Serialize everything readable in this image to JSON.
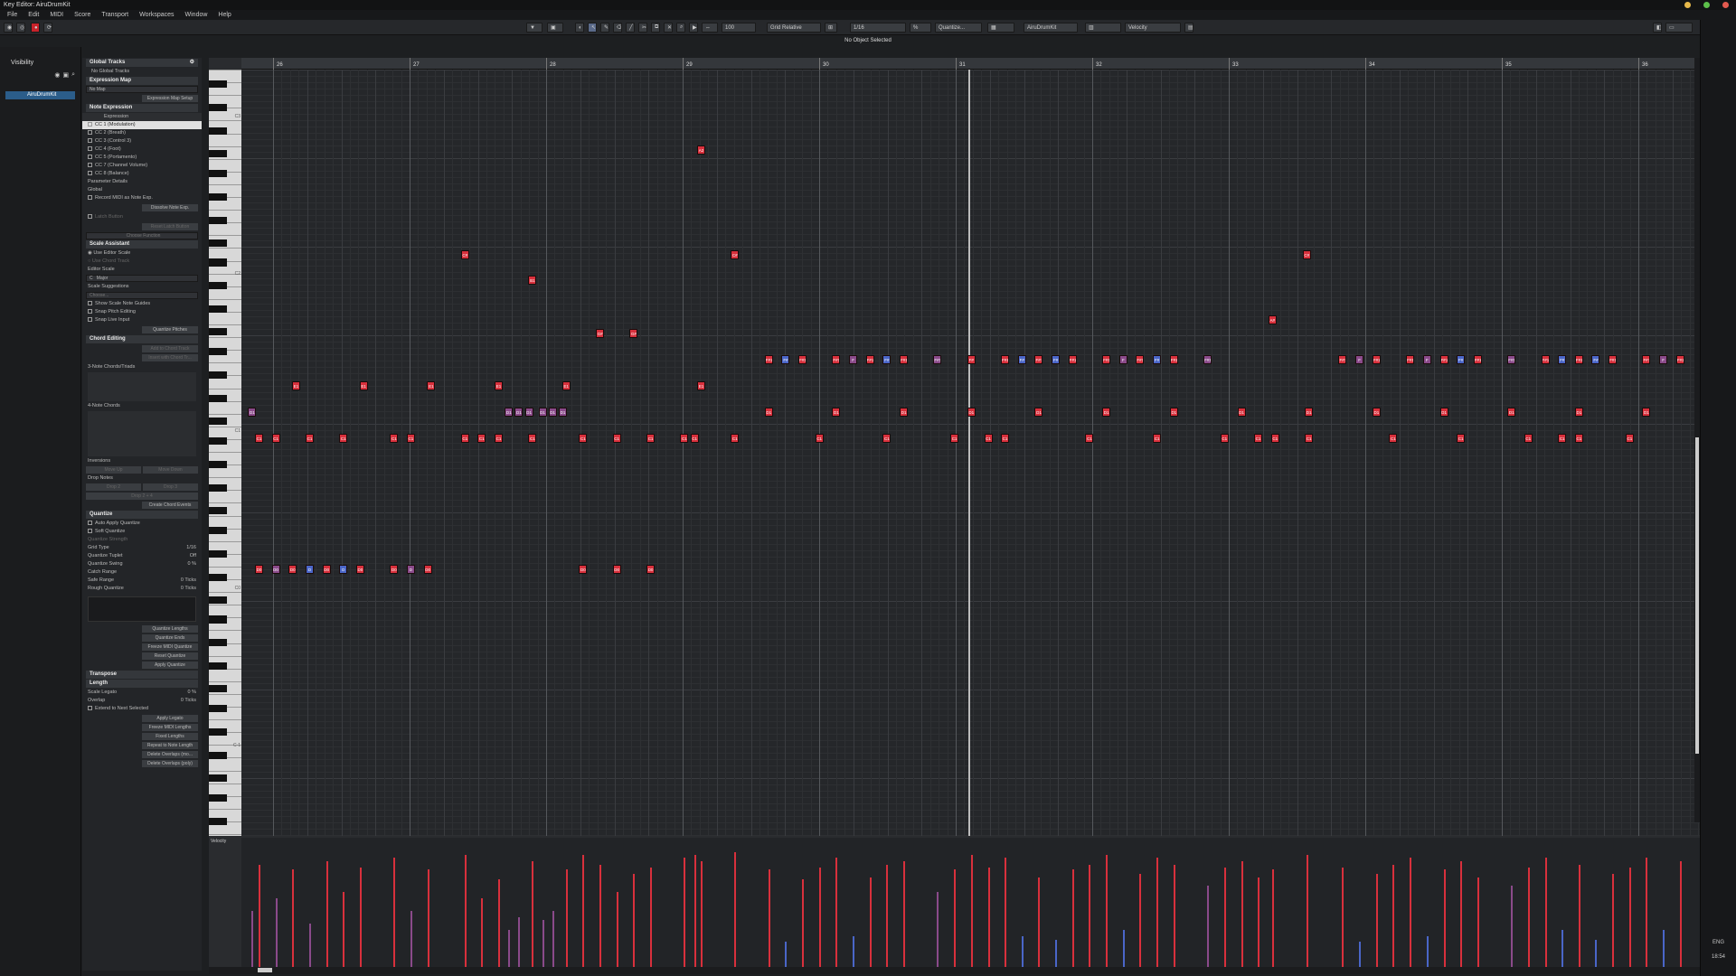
{
  "app": {
    "title": "Key Editor: AiruDrumKit"
  },
  "menu": [
    "File",
    "Edit",
    "MIDI",
    "Score",
    "Transport",
    "Workspaces",
    "Window",
    "Help"
  ],
  "toolbar": {
    "zoom": "100",
    "grid_mode": "Grid Relative",
    "grid_value": "1/16",
    "quantize": "Quantize...",
    "instrument": "AiruDrumKit",
    "controller": "Velocity"
  },
  "status": "No Object Selected",
  "visibility": {
    "title": "Visibility",
    "track": "AiruDrumKit"
  },
  "inspector": {
    "global_tracks": "Global Tracks",
    "no_global": "No Global Tracks",
    "expression_map": "Expression Map",
    "no_map": "No Map",
    "map_setup": "Expression Map Setup",
    "note_expression": "Note Expression",
    "expr_header": "Expression",
    "cc": [
      "CC 1 (Modulation)",
      "CC 2 (Breath)",
      "CC 3 (Control 3)",
      "CC 4 (Foot)",
      "CC 5 (Portamento)",
      "CC 7 (Channel Volume)",
      "CC 8 (Balance)"
    ],
    "param_details": "Parameter Details",
    "global": "Global",
    "record_midi": "Record MIDI as Note Exp.",
    "dissolve": "Dissolve Note Exp.",
    "latch": "Latch Button",
    "reset_latch": "Reset Latch Button",
    "choose_function": "Choose Function",
    "scale_assistant": "Scale Assistant",
    "use_editor_scale": "Use Editor Scale",
    "use_chord_track": "Use Chord Track",
    "editor_scale": "Editor Scale",
    "scale_key": "C",
    "scale_mode": "Major",
    "scale_suggestions": "Scale Suggestions",
    "choose": "Choose...",
    "show_guides": "Show Scale Note Guides",
    "snap_pitch": "Snap Pitch Editing",
    "snap_live": "Snap Live Input",
    "quantize_pitches": "Quantize Pitches",
    "chord_editing": "Chord Editing",
    "add_chord": "Add to Chord Track",
    "insert_chord": "Insert with Chord Tr...",
    "three_note": "3-Note Chords/Triads",
    "four_note": "4-Note Chords",
    "inversions": "Inversions",
    "move_up": "Move Up",
    "move_down": "Move Down",
    "drop_notes": "Drop Notes",
    "drop2": "Drop 2",
    "drop3": "Drop 3",
    "drop24": "Drop 2 + 4",
    "create_chord": "Create Chord Events",
    "quantize": "Quantize",
    "auto_apply": "Auto Apply Quantize",
    "soft_quantize": "Soft Quantize",
    "q_strength": "Quantize Strength",
    "grid_type": "Grid Type",
    "grid_type_val": "1/16",
    "q_tuplet": "Quantize Tuplet",
    "q_tuplet_val": "Off",
    "q_swing": "Quantize Swing",
    "q_swing_val": "0 %",
    "catch": "Catch Range",
    "safe": "Safe Range",
    "safe_val": "0 Ticks",
    "rough": "Rough Quantize",
    "rough_val": "0 Ticks",
    "q_lengths": "Quantize Lengths",
    "q_ends": "Quantize Ends",
    "freeze": "Freeze MIDI Quantize",
    "reset_q": "Reset Quantize",
    "apply_q": "Apply Quantize",
    "transpose": "Transpose",
    "length": "Length",
    "scale_legato": "Scale Legato",
    "scale_legato_val": "0 %",
    "overlap": "Overlap",
    "overlap_val": "0 Ticks",
    "extend": "Extend to Next Selected",
    "apply_legato": "Apply Legato",
    "freeze_lengths": "Freeze MIDI Lengths",
    "fixed_lengths": "Fixed Lengths",
    "repeat_length": "Repeat to Note Length",
    "delete_overlaps_mono": "Delete Overlaps (mo...",
    "delete_overlaps_poly": "Delete Overlaps (poly)"
  },
  "ruler": [
    "26",
    "27",
    "28",
    "29",
    "30",
    "31",
    "32",
    "33",
    "34",
    "35",
    "36"
  ],
  "keyboard_labels": [
    "C3",
    "C2",
    "C1",
    "C0",
    "C-1"
  ],
  "velocity_label": "Velocity",
  "clock": "18:54",
  "lang": "ENG",
  "colors": {
    "note_red": "#d8303c",
    "note_blue": "#4a66c8",
    "note_purple": "#8a4a8a"
  },
  "notes": [
    {
      "t": "A2",
      "x": 0.3125,
      "row": 0,
      "c": "r"
    },
    {
      "t": "C#",
      "x": 0.1505,
      "row": 1,
      "c": "r"
    },
    {
      "t": "C#",
      "x": 0.3356,
      "row": 1,
      "c": "r"
    },
    {
      "t": "C#",
      "x": 0.7277,
      "row": 1,
      "c": "r"
    },
    {
      "t": "B1",
      "x": 0.1968,
      "row": 2,
      "c": "r"
    },
    {
      "t": "A#",
      "x": 0.7041,
      "row": 3,
      "c": "r"
    },
    {
      "t": "G#",
      "x": 0.2431,
      "row": 4,
      "c": "r"
    },
    {
      "t": "G#",
      "x": 0.2662,
      "row": 4,
      "c": "r"
    },
    {
      "t": "F#1",
      "x": 0.3588,
      "row": 5,
      "c": "r"
    },
    {
      "t": "F#",
      "x": 0.3704,
      "row": 5,
      "c": "b"
    },
    {
      "t": "F#1",
      "x": 0.382,
      "row": 5,
      "c": "r"
    },
    {
      "t": "F#1",
      "x": 0.4051,
      "row": 5,
      "c": "r"
    },
    {
      "t": "F",
      "x": 0.4167,
      "row": 5,
      "c": "p"
    },
    {
      "t": "F#1",
      "x": 0.4282,
      "row": 5,
      "c": "r"
    },
    {
      "t": "F#",
      "x": 0.4398,
      "row": 5,
      "c": "b"
    },
    {
      "t": "F#1",
      "x": 0.4514,
      "row": 5,
      "c": "r"
    },
    {
      "t": "F#1",
      "x": 0.4745,
      "row": 5,
      "c": "p"
    },
    {
      "t": "F#",
      "x": 0.4977,
      "row": 5,
      "c": "r"
    },
    {
      "t": "F#1",
      "x": 0.5208,
      "row": 5,
      "c": "r"
    },
    {
      "t": "F#",
      "x": 0.5324,
      "row": 5,
      "c": "b"
    },
    {
      "t": "F#1",
      "x": 0.544,
      "row": 5,
      "c": "r"
    },
    {
      "t": "F#",
      "x": 0.5556,
      "row": 5,
      "c": "b"
    },
    {
      "t": "F#1",
      "x": 0.5671,
      "row": 5,
      "c": "r"
    },
    {
      "t": "F#1",
      "x": 0.5903,
      "row": 5,
      "c": "r"
    },
    {
      "t": "F",
      "x": 0.6019,
      "row": 5,
      "c": "p"
    },
    {
      "t": "F#1",
      "x": 0.6134,
      "row": 5,
      "c": "r"
    },
    {
      "t": "F#",
      "x": 0.625,
      "row": 5,
      "c": "b"
    },
    {
      "t": "F#1",
      "x": 0.6366,
      "row": 5,
      "c": "r"
    },
    {
      "t": "F#1",
      "x": 0.6597,
      "row": 5,
      "c": "p"
    },
    {
      "t": "F#1",
      "x": 0.7523,
      "row": 5,
      "c": "r"
    },
    {
      "t": "F",
      "x": 0.7639,
      "row": 5,
      "c": "p"
    },
    {
      "t": "F#1",
      "x": 0.7755,
      "row": 5,
      "c": "r"
    },
    {
      "t": "F#1",
      "x": 0.7986,
      "row": 5,
      "c": "r"
    },
    {
      "t": "F",
      "x": 0.8102,
      "row": 5,
      "c": "p"
    },
    {
      "t": "F#1",
      "x": 0.8218,
      "row": 5,
      "c": "r"
    },
    {
      "t": "F#",
      "x": 0.8333,
      "row": 5,
      "c": "b"
    },
    {
      "t": "F#1",
      "x": 0.8449,
      "row": 5,
      "c": "r"
    },
    {
      "t": "F#1",
      "x": 0.8681,
      "row": 5,
      "c": "p"
    },
    {
      "t": "F#1",
      "x": 0.8912,
      "row": 5,
      "c": "r"
    },
    {
      "t": "F#",
      "x": 0.9028,
      "row": 5,
      "c": "b"
    },
    {
      "t": "F#1",
      "x": 0.9144,
      "row": 5,
      "c": "r"
    },
    {
      "t": "F#",
      "x": 0.9259,
      "row": 5,
      "c": "b"
    },
    {
      "t": "F#1",
      "x": 0.9375,
      "row": 5,
      "c": "r"
    },
    {
      "t": "F#1",
      "x": 0.9606,
      "row": 5,
      "c": "r"
    },
    {
      "t": "F",
      "x": 0.9722,
      "row": 5,
      "c": "p"
    },
    {
      "t": "F#1",
      "x": 0.9838,
      "row": 5,
      "c": "r"
    },
    {
      "t": "E1",
      "x": 0.0347,
      "row": 6,
      "c": "r"
    },
    {
      "t": "E1",
      "x": 0.081,
      "row": 6,
      "c": "r"
    },
    {
      "t": "E1",
      "x": 0.1273,
      "row": 6,
      "c": "r"
    },
    {
      "t": "E1",
      "x": 0.1736,
      "row": 6,
      "c": "r"
    },
    {
      "t": "E1",
      "x": 0.2199,
      "row": 6,
      "c": "r"
    },
    {
      "t": "E1",
      "x": 0.3125,
      "row": 6,
      "c": "r"
    },
    {
      "t": "D1",
      "x": 0.0046,
      "row": 7,
      "c": "p"
    },
    {
      "t": "D1",
      "x": 0.1806,
      "row": 7,
      "c": "p"
    },
    {
      "t": "D1",
      "x": 0.1875,
      "row": 7,
      "c": "p"
    },
    {
      "t": "D1",
      "x": 0.1944,
      "row": 7,
      "c": "p"
    },
    {
      "t": "D1",
      "x": 0.2037,
      "row": 7,
      "c": "p"
    },
    {
      "t": "D1",
      "x": 0.2106,
      "row": 7,
      "c": "p"
    },
    {
      "t": "D1",
      "x": 0.2176,
      "row": 7,
      "c": "p"
    },
    {
      "t": "D1",
      "x": 0.3588,
      "row": 7,
      "c": "r"
    },
    {
      "t": "D1",
      "x": 0.4051,
      "row": 7,
      "c": "r"
    },
    {
      "t": "D1",
      "x": 0.4514,
      "row": 7,
      "c": "r"
    },
    {
      "t": "D1",
      "x": 0.4977,
      "row": 7,
      "c": "r"
    },
    {
      "t": "D1",
      "x": 0.544,
      "row": 7,
      "c": "r"
    },
    {
      "t": "D1",
      "x": 0.5903,
      "row": 7,
      "c": "r"
    },
    {
      "t": "D1",
      "x": 0.6366,
      "row": 7,
      "c": "r"
    },
    {
      "t": "D1",
      "x": 0.6829,
      "row": 7,
      "c": "r"
    },
    {
      "t": "D1",
      "x": 0.7292,
      "row": 7,
      "c": "r"
    },
    {
      "t": "D1",
      "x": 0.7755,
      "row": 7,
      "c": "r"
    },
    {
      "t": "D1",
      "x": 0.8218,
      "row": 7,
      "c": "r"
    },
    {
      "t": "D1",
      "x": 0.8681,
      "row": 7,
      "c": "r"
    },
    {
      "t": "D1",
      "x": 0.9144,
      "row": 7,
      "c": "r"
    },
    {
      "t": "D1",
      "x": 0.9606,
      "row": 7,
      "c": "r"
    },
    {
      "t": "C1",
      "x": 0.0093,
      "row": 8,
      "c": "r"
    },
    {
      "t": "C1",
      "x": 0.0208,
      "row": 8,
      "c": "r"
    },
    {
      "t": "C1",
      "x": 0.044,
      "row": 8,
      "c": "r"
    },
    {
      "t": "C1",
      "x": 0.0671,
      "row": 8,
      "c": "r"
    },
    {
      "t": "C1",
      "x": 0.1019,
      "row": 8,
      "c": "r"
    },
    {
      "t": "C1",
      "x": 0.1134,
      "row": 8,
      "c": "r"
    },
    {
      "t": "C1",
      "x": 0.1505,
      "row": 8,
      "c": "r"
    },
    {
      "t": "C1",
      "x": 0.162,
      "row": 8,
      "c": "r"
    },
    {
      "t": "C1",
      "x": 0.1736,
      "row": 8,
      "c": "r"
    },
    {
      "t": "C1",
      "x": 0.1968,
      "row": 8,
      "c": "r"
    },
    {
      "t": "C1",
      "x": 0.2315,
      "row": 8,
      "c": "r"
    },
    {
      "t": "C1",
      "x": 0.2546,
      "row": 8,
      "c": "r"
    },
    {
      "t": "C1",
      "x": 0.2778,
      "row": 8,
      "c": "r"
    },
    {
      "t": "C1",
      "x": 0.3009,
      "row": 8,
      "c": "r"
    },
    {
      "t": "C1",
      "x": 0.3079,
      "row": 8,
      "c": "r"
    },
    {
      "t": "C1",
      "x": 0.3356,
      "row": 8,
      "c": "r"
    },
    {
      "t": "C1",
      "x": 0.3935,
      "row": 8,
      "c": "r"
    },
    {
      "t": "C1",
      "x": 0.4398,
      "row": 8,
      "c": "r"
    },
    {
      "t": "C1",
      "x": 0.4861,
      "row": 8,
      "c": "r"
    },
    {
      "t": "C1",
      "x": 0.5093,
      "row": 8,
      "c": "r"
    },
    {
      "t": "C1",
      "x": 0.5208,
      "row": 8,
      "c": "r"
    },
    {
      "t": "C1",
      "x": 0.5787,
      "row": 8,
      "c": "r"
    },
    {
      "t": "C1",
      "x": 0.625,
      "row": 8,
      "c": "r"
    },
    {
      "t": "C1",
      "x": 0.6713,
      "row": 8,
      "c": "r"
    },
    {
      "t": "C1",
      "x": 0.6944,
      "row": 8,
      "c": "r"
    },
    {
      "t": "C1",
      "x": 0.706,
      "row": 8,
      "c": "r"
    },
    {
      "t": "C1",
      "x": 0.7292,
      "row": 8,
      "c": "r"
    },
    {
      "t": "C1",
      "x": 0.787,
      "row": 8,
      "c": "r"
    },
    {
      "t": "C1",
      "x": 0.8333,
      "row": 8,
      "c": "r"
    },
    {
      "t": "C1",
      "x": 0.8796,
      "row": 8,
      "c": "r"
    },
    {
      "t": "C1",
      "x": 0.9028,
      "row": 8,
      "c": "r"
    },
    {
      "t": "C1",
      "x": 0.9144,
      "row": 8,
      "c": "r"
    },
    {
      "t": "C1",
      "x": 0.9491,
      "row": 8,
      "c": "r"
    },
    {
      "t": "D0",
      "x": 0.0093,
      "row": 9,
      "c": "r"
    },
    {
      "t": "D0",
      "x": 0.0208,
      "row": 9,
      "c": "p"
    },
    {
      "t": "D0",
      "x": 0.0324,
      "row": 9,
      "c": "r"
    },
    {
      "t": "D",
      "x": 0.044,
      "row": 9,
      "c": "b"
    },
    {
      "t": "D0",
      "x": 0.0556,
      "row": 9,
      "c": "r"
    },
    {
      "t": "D",
      "x": 0.0671,
      "row": 9,
      "c": "b"
    },
    {
      "t": "D0",
      "x": 0.0787,
      "row": 9,
      "c": "r"
    },
    {
      "t": "D0",
      "x": 0.1019,
      "row": 9,
      "c": "r"
    },
    {
      "t": "D",
      "x": 0.1134,
      "row": 9,
      "c": "p"
    },
    {
      "t": "D0",
      "x": 0.125,
      "row": 9,
      "c": "r"
    },
    {
      "t": "D0",
      "x": 0.2315,
      "row": 9,
      "c": "r"
    },
    {
      "t": "D0",
      "x": 0.2546,
      "row": 9,
      "c": "r"
    },
    {
      "t": "D0",
      "x": 0.2778,
      "row": 9,
      "c": "r"
    }
  ],
  "velocity": [
    {
      "x": 0.0046,
      "v": 0.45,
      "c": "p"
    },
    {
      "x": 0.0093,
      "v": 0.82,
      "c": "r"
    },
    {
      "x": 0.0208,
      "v": 0.55,
      "c": "p"
    },
    {
      "x": 0.0324,
      "v": 0.78,
      "c": "r"
    },
    {
      "x": 0.044,
      "v": 0.35,
      "c": "p"
    },
    {
      "x": 0.0556,
      "v": 0.85,
      "c": "r"
    },
    {
      "x": 0.0671,
      "v": 0.6,
      "c": "r"
    },
    {
      "x": 0.0787,
      "v": 0.8,
      "c": "r"
    },
    {
      "x": 0.1019,
      "v": 0.88,
      "c": "r"
    },
    {
      "x": 0.1134,
      "v": 0.45,
      "c": "p"
    },
    {
      "x": 0.125,
      "v": 0.78,
      "c": "r"
    },
    {
      "x": 0.1505,
      "v": 0.9,
      "c": "r"
    },
    {
      "x": 0.162,
      "v": 0.55,
      "c": "r"
    },
    {
      "x": 0.1736,
      "v": 0.7,
      "c": "r"
    },
    {
      "x": 0.1806,
      "v": 0.3,
      "c": "p"
    },
    {
      "x": 0.1875,
      "v": 0.4,
      "c": "p"
    },
    {
      "x": 0.1968,
      "v": 0.85,
      "c": "r"
    },
    {
      "x": 0.2037,
      "v": 0.38,
      "c": "p"
    },
    {
      "x": 0.2106,
      "v": 0.45,
      "c": "p"
    },
    {
      "x": 0.2199,
      "v": 0.78,
      "c": "r"
    },
    {
      "x": 0.2315,
      "v": 0.9,
      "c": "r"
    },
    {
      "x": 0.2431,
      "v": 0.82,
      "c": "r"
    },
    {
      "x": 0.2546,
      "v": 0.6,
      "c": "r"
    },
    {
      "x": 0.2662,
      "v": 0.75,
      "c": "r"
    },
    {
      "x": 0.2778,
      "v": 0.8,
      "c": "r"
    },
    {
      "x": 0.3009,
      "v": 0.88,
      "c": "r"
    },
    {
      "x": 0.3079,
      "v": 0.9,
      "c": "r"
    },
    {
      "x": 0.3125,
      "v": 0.85,
      "c": "r"
    },
    {
      "x": 0.3356,
      "v": 0.92,
      "c": "r"
    },
    {
      "x": 0.3588,
      "v": 0.78,
      "c": "r"
    },
    {
      "x": 0.3704,
      "v": 0.2,
      "c": "b"
    },
    {
      "x": 0.382,
      "v": 0.7,
      "c": "r"
    },
    {
      "x": 0.3935,
      "v": 0.8,
      "c": "r"
    },
    {
      "x": 0.4051,
      "v": 0.88,
      "c": "r"
    },
    {
      "x": 0.4167,
      "v": 0.25,
      "c": "b"
    },
    {
      "x": 0.4282,
      "v": 0.72,
      "c": "r"
    },
    {
      "x": 0.4398,
      "v": 0.82,
      "c": "r"
    },
    {
      "x": 0.4514,
      "v": 0.85,
      "c": "r"
    },
    {
      "x": 0.4745,
      "v": 0.6,
      "c": "p"
    },
    {
      "x": 0.4861,
      "v": 0.78,
      "c": "r"
    },
    {
      "x": 0.4977,
      "v": 0.9,
      "c": "r"
    },
    {
      "x": 0.5093,
      "v": 0.8,
      "c": "r"
    },
    {
      "x": 0.5208,
      "v": 0.88,
      "c": "r"
    },
    {
      "x": 0.5324,
      "v": 0.25,
      "c": "b"
    },
    {
      "x": 0.544,
      "v": 0.72,
      "c": "r"
    },
    {
      "x": 0.5556,
      "v": 0.22,
      "c": "b"
    },
    {
      "x": 0.5671,
      "v": 0.78,
      "c": "r"
    },
    {
      "x": 0.5787,
      "v": 0.82,
      "c": "r"
    },
    {
      "x": 0.5903,
      "v": 0.9,
      "c": "r"
    },
    {
      "x": 0.6019,
      "v": 0.3,
      "c": "b"
    },
    {
      "x": 0.6134,
      "v": 0.75,
      "c": "r"
    },
    {
      "x": 0.625,
      "v": 0.88,
      "c": "r"
    },
    {
      "x": 0.6366,
      "v": 0.82,
      "c": "r"
    },
    {
      "x": 0.6597,
      "v": 0.65,
      "c": "p"
    },
    {
      "x": 0.6713,
      "v": 0.8,
      "c": "r"
    },
    {
      "x": 0.6829,
      "v": 0.85,
      "c": "r"
    },
    {
      "x": 0.6944,
      "v": 0.72,
      "c": "r"
    },
    {
      "x": 0.7041,
      "v": 0.78,
      "c": "r"
    },
    {
      "x": 0.7277,
      "v": 0.9,
      "c": "r"
    },
    {
      "x": 0.7523,
      "v": 0.8,
      "c": "r"
    },
    {
      "x": 0.7639,
      "v": 0.2,
      "c": "b"
    },
    {
      "x": 0.7755,
      "v": 0.75,
      "c": "r"
    },
    {
      "x": 0.787,
      "v": 0.82,
      "c": "r"
    },
    {
      "x": 0.7986,
      "v": 0.88,
      "c": "r"
    },
    {
      "x": 0.8102,
      "v": 0.25,
      "c": "b"
    },
    {
      "x": 0.8218,
      "v": 0.78,
      "c": "r"
    },
    {
      "x": 0.8333,
      "v": 0.85,
      "c": "r"
    },
    {
      "x": 0.8449,
      "v": 0.72,
      "c": "r"
    },
    {
      "x": 0.8681,
      "v": 0.65,
      "c": "p"
    },
    {
      "x": 0.8796,
      "v": 0.8,
      "c": "r"
    },
    {
      "x": 0.8912,
      "v": 0.88,
      "c": "r"
    },
    {
      "x": 0.9028,
      "v": 0.3,
      "c": "b"
    },
    {
      "x": 0.9144,
      "v": 0.82,
      "c": "r"
    },
    {
      "x": 0.9259,
      "v": 0.22,
      "c": "b"
    },
    {
      "x": 0.9375,
      "v": 0.75,
      "c": "r"
    },
    {
      "x": 0.9491,
      "v": 0.8,
      "c": "r"
    },
    {
      "x": 0.9606,
      "v": 0.88,
      "c": "r"
    },
    {
      "x": 0.9722,
      "v": 0.3,
      "c": "b"
    },
    {
      "x": 0.9838,
      "v": 0.85,
      "c": "r"
    }
  ]
}
